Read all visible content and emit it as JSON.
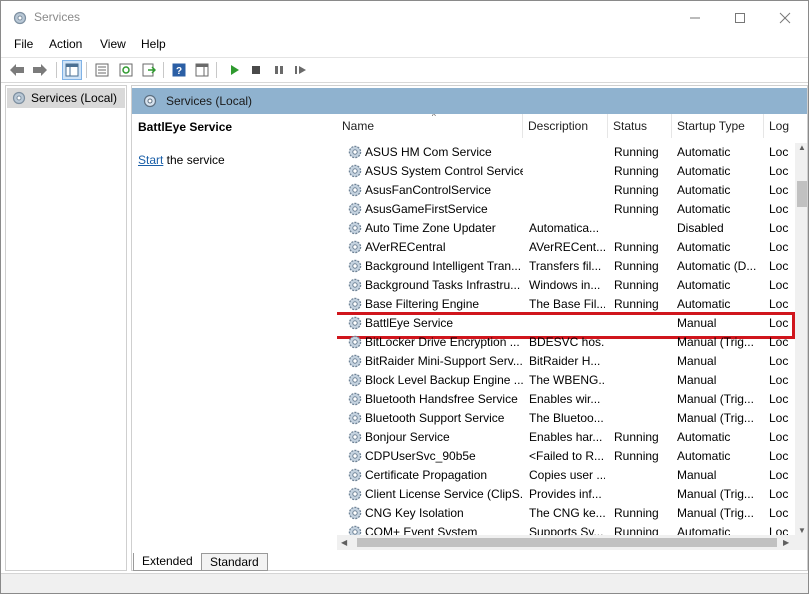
{
  "window": {
    "title": "Services"
  },
  "menu": [
    "File",
    "Action",
    "View",
    "Help"
  ],
  "tree": {
    "root_label": "Services (Local)"
  },
  "pane_header": "Services (Local)",
  "selected_service": {
    "name": "BattlEye Service",
    "action_link": "Start",
    "action_suffix": " the service"
  },
  "columns": {
    "name": "Name",
    "description": "Description",
    "status": "Status",
    "startup_type": "Startup Type",
    "log_on_as": "Log"
  },
  "services": [
    {
      "name": "ASUS HM Com Service",
      "description": "",
      "status": "Running",
      "startup_type": "Automatic",
      "log_on_as": "Loc"
    },
    {
      "name": "ASUS System Control Service",
      "description": "",
      "status": "Running",
      "startup_type": "Automatic",
      "log_on_as": "Loc"
    },
    {
      "name": "AsusFanControlService",
      "description": "",
      "status": "Running",
      "startup_type": "Automatic",
      "log_on_as": "Loc"
    },
    {
      "name": "AsusGameFirstService",
      "description": "",
      "status": "Running",
      "startup_type": "Automatic",
      "log_on_as": "Loc"
    },
    {
      "name": "Auto Time Zone Updater",
      "description": "Automatica...",
      "status": "",
      "startup_type": "Disabled",
      "log_on_as": "Loc"
    },
    {
      "name": "AVerRECentral",
      "description": "AVerRECent...",
      "status": "Running",
      "startup_type": "Automatic",
      "log_on_as": "Loc"
    },
    {
      "name": "Background Intelligent Tran...",
      "description": "Transfers fil...",
      "status": "Running",
      "startup_type": "Automatic (D...",
      "log_on_as": "Loc"
    },
    {
      "name": "Background Tasks Infrastru...",
      "description": "Windows in...",
      "status": "Running",
      "startup_type": "Automatic",
      "log_on_as": "Loc"
    },
    {
      "name": "Base Filtering Engine",
      "description": "The Base Fil...",
      "status": "Running",
      "startup_type": "Automatic",
      "log_on_as": "Loc"
    },
    {
      "name": "BattlEye Service",
      "description": "",
      "status": "",
      "startup_type": "Manual",
      "log_on_as": "Loc"
    },
    {
      "name": "BitLocker Drive Encryption ...",
      "description": "BDESVC hos...",
      "status": "",
      "startup_type": "Manual (Trig...",
      "log_on_as": "Loc"
    },
    {
      "name": "BitRaider Mini-Support Serv...",
      "description": "BitRaider H...",
      "status": "",
      "startup_type": "Manual",
      "log_on_as": "Loc"
    },
    {
      "name": "Block Level Backup Engine ...",
      "description": "The WBENG...",
      "status": "",
      "startup_type": "Manual",
      "log_on_as": "Loc"
    },
    {
      "name": "Bluetooth Handsfree Service",
      "description": "Enables wir...",
      "status": "",
      "startup_type": "Manual (Trig...",
      "log_on_as": "Loc"
    },
    {
      "name": "Bluetooth Support Service",
      "description": "The Bluetoo...",
      "status": "",
      "startup_type": "Manual (Trig...",
      "log_on_as": "Loc"
    },
    {
      "name": "Bonjour Service",
      "description": "Enables har...",
      "status": "Running",
      "startup_type": "Automatic",
      "log_on_as": "Loc"
    },
    {
      "name": "CDPUserSvc_90b5e",
      "description": "<Failed to R...",
      "status": "Running",
      "startup_type": "Automatic",
      "log_on_as": "Loc"
    },
    {
      "name": "Certificate Propagation",
      "description": "Copies user ...",
      "status": "",
      "startup_type": "Manual",
      "log_on_as": "Loc"
    },
    {
      "name": "Client License Service (ClipS...",
      "description": "Provides inf...",
      "status": "",
      "startup_type": "Manual (Trig...",
      "log_on_as": "Loc"
    },
    {
      "name": "CNG Key Isolation",
      "description": "The CNG ke...",
      "status": "Running",
      "startup_type": "Manual (Trig...",
      "log_on_as": "Loc"
    },
    {
      "name": "COM+ Event System",
      "description": "Supports Sy...",
      "status": "Running",
      "startup_type": "Automatic",
      "log_on_as": "Loc"
    }
  ],
  "selected_index": 9,
  "tabs": [
    "Extended",
    "Standard"
  ],
  "colors": {
    "header_bar": "#8fb2cf",
    "highlight_border": "#d0151c",
    "link": "#1a5fa8"
  }
}
